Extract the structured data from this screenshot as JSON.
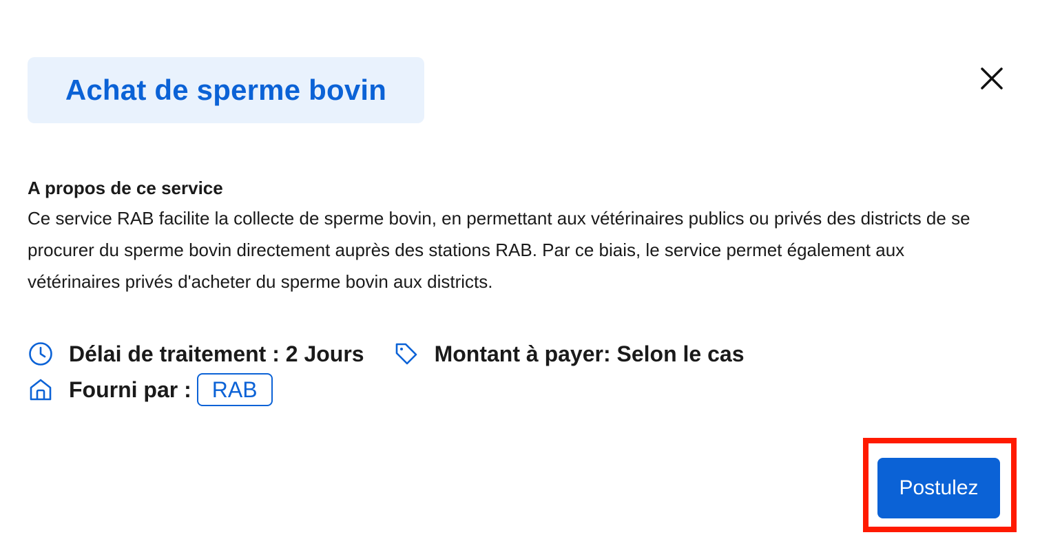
{
  "modal": {
    "title": "Achat de sperme bovin",
    "close_icon": "close-icon"
  },
  "about": {
    "heading": "A propos de ce service",
    "description": "Ce service RAB facilite la collecte de sperme bovin, en permettant aux vétérinaires publics ou privés des districts de se procurer du sperme bovin directement auprès des stations RAB. Par ce biais, le service permet également aux vétérinaires privés d'acheter du sperme bovin aux districts."
  },
  "meta": {
    "processing_time": "Délai de traitement : 2 Jours",
    "amount": "Montant à payer: Selon le cas",
    "provider_label": "Fourni par :",
    "provider": "RAB"
  },
  "actions": {
    "apply_label": "Postulez"
  },
  "colors": {
    "accent": "#0b62d6",
    "title_bg": "#e9f2fd",
    "highlight": "#ff1a00"
  }
}
